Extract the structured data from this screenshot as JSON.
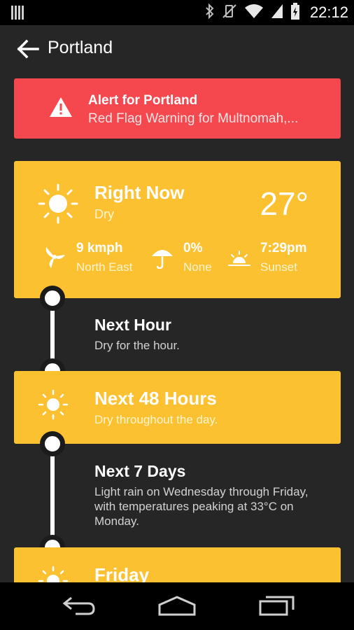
{
  "status_bar": {
    "time": "22:12",
    "icons": [
      "notification-bars-icon",
      "bluetooth-icon",
      "vibrate-off-icon",
      "wifi-icon",
      "signal-icon",
      "battery-charging-icon"
    ]
  },
  "app_bar": {
    "title": "Portland",
    "back_icon": "arrow-left-icon"
  },
  "alert": {
    "title": "Alert for Portland",
    "message": "Red Flag Warning for Multnomah,...",
    "icon": "warning-triangle-icon",
    "color": "#f4474e"
  },
  "right_now": {
    "title": "Right Now",
    "condition": "Dry",
    "temperature": "27°",
    "icon": "sun-icon",
    "stats": [
      {
        "value": "9 kmph",
        "label": "North East",
        "icon": "wind-icon"
      },
      {
        "value": "0%",
        "label": "None",
        "icon": "umbrella-icon"
      },
      {
        "value": "7:29pm",
        "label": "Sunset",
        "icon": "sunset-icon"
      }
    ]
  },
  "next_hour": {
    "title": "Next Hour",
    "text": "Dry for the hour."
  },
  "next_48": {
    "title": "Next 48 Hours",
    "text": "Dry throughout the day.",
    "icon": "sun-icon"
  },
  "next_7": {
    "title": "Next 7 Days",
    "lines": [
      "Light rain on Wednesday through Friday,",
      "with temperatures peaking at 33°C on",
      "Monday."
    ]
  },
  "friday": {
    "title": "Friday",
    "icon": "sun-icon"
  },
  "nav_bar": {
    "buttons": [
      "back-nav-icon",
      "home-nav-icon",
      "recents-nav-icon"
    ]
  },
  "colors": {
    "background": "#262626",
    "card": "#fcc131",
    "alert": "#f4474e"
  }
}
